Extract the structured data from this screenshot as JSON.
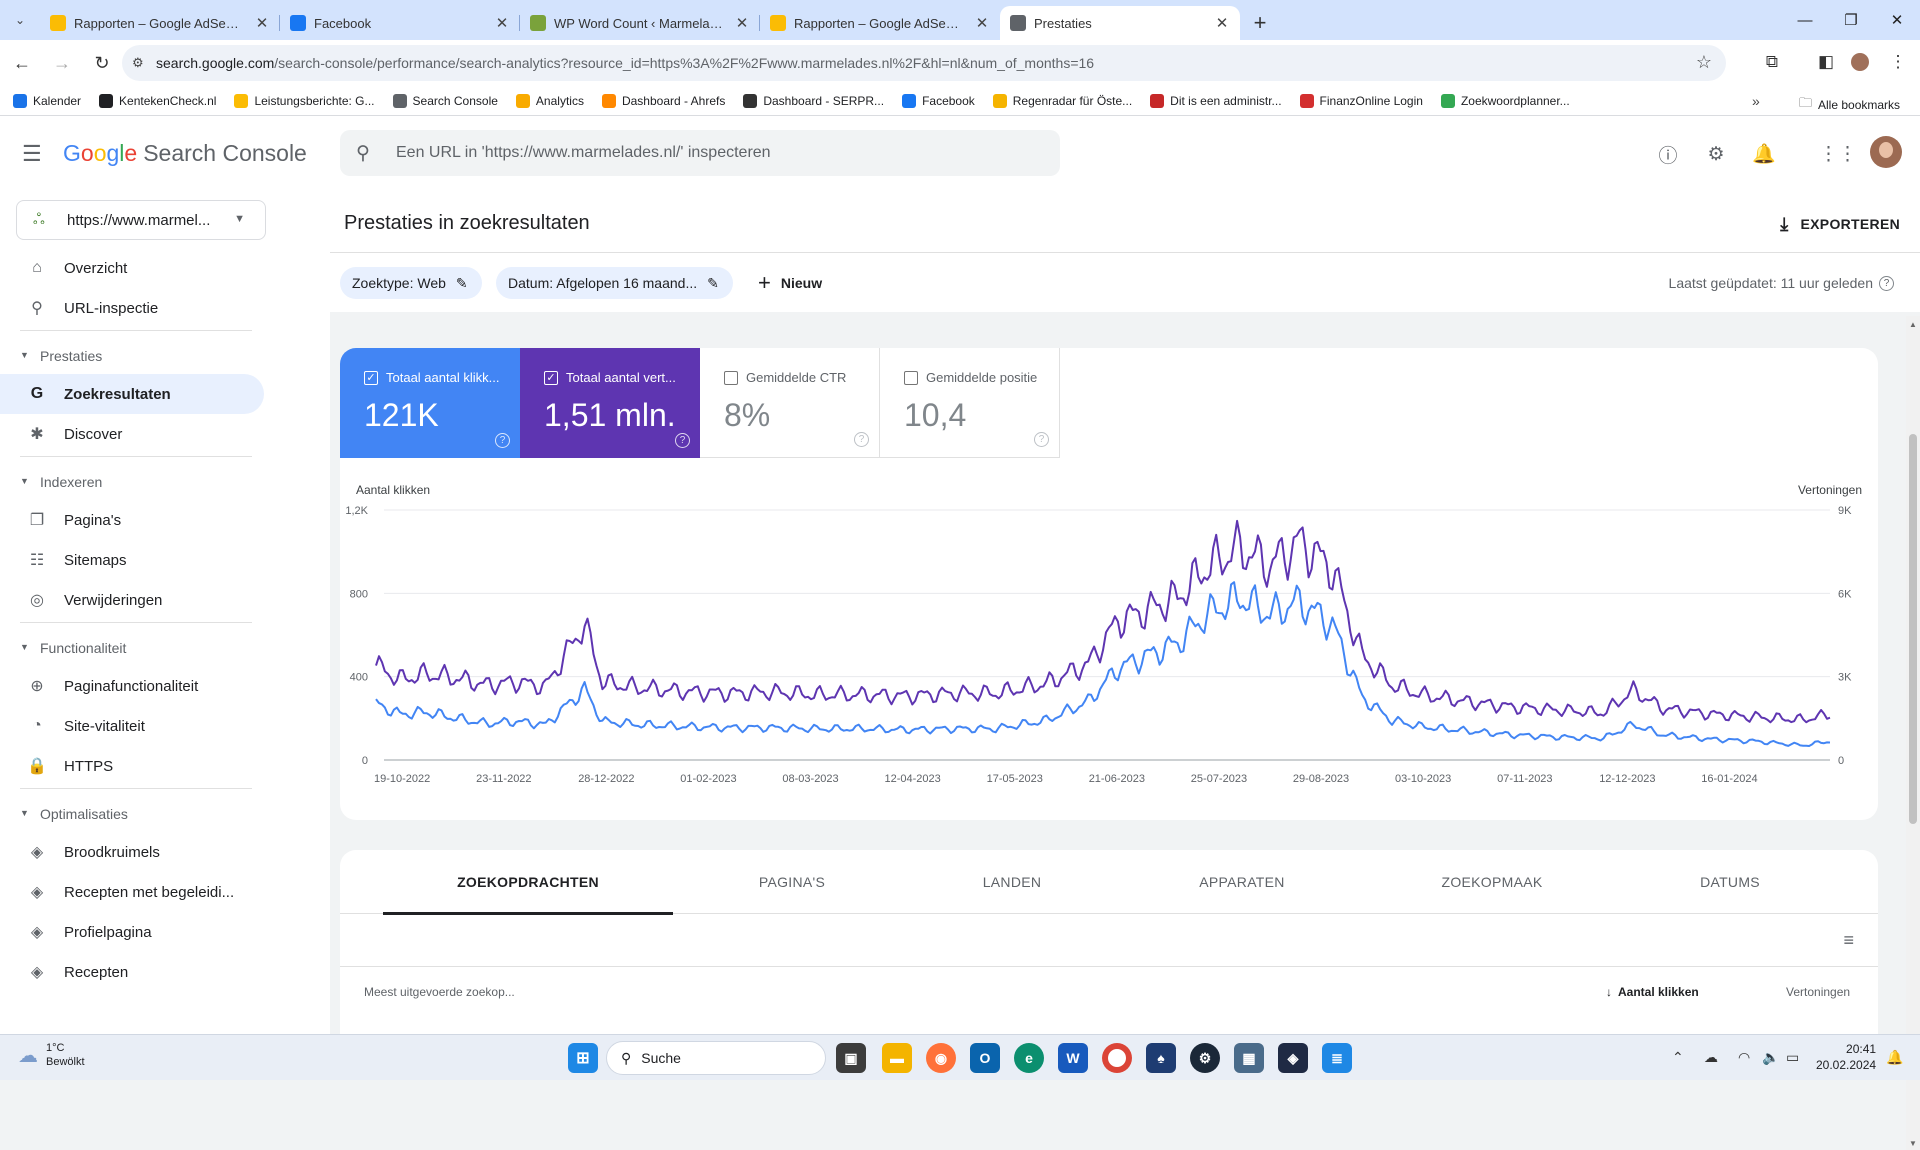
{
  "browser": {
    "tabs": [
      {
        "title": "Rapporten – Google AdSense",
        "icon": "adsense-icon",
        "color": "#fbbc04",
        "active": false
      },
      {
        "title": "Facebook",
        "icon": "facebook-icon",
        "color": "#1877f2",
        "active": false
      },
      {
        "title": "WP Word Count ‹ Marmelades",
        "icon": "wordpress-icon",
        "color": "#7aa23b",
        "active": false
      },
      {
        "title": "Rapporten – Google AdSense",
        "icon": "adsense-icon",
        "color": "#fbbc04",
        "active": false
      },
      {
        "title": "Prestaties",
        "icon": "search-console-icon",
        "color": "#5f6368",
        "active": true
      }
    ],
    "url_host": "search.google.com",
    "url_path": "/search-console/performance/search-analytics?resource_id=https%3A%2F%2Fwww.marmelades.nl%2F&hl=nl&num_of_months=16",
    "bookmarks": [
      {
        "label": "Kalender",
        "color": "#1a73e8"
      },
      {
        "label": "KentekenCheck.nl",
        "color": "#202124"
      },
      {
        "label": "Leistungsberichte: G...",
        "color": "#fbbc04"
      },
      {
        "label": "Search Console",
        "color": "#5f6368"
      },
      {
        "label": "Analytics",
        "color": "#f9ab00"
      },
      {
        "label": "Dashboard - Ahrefs",
        "color": "#ff8800"
      },
      {
        "label": "Dashboard - SERPR...",
        "color": "#333333"
      },
      {
        "label": "Facebook",
        "color": "#1877f2"
      },
      {
        "label": "Regenradar für Öste...",
        "color": "#f5b400"
      },
      {
        "label": "Dit is een administr...",
        "color": "#c62828"
      },
      {
        "label": "FinanzOnline Login",
        "color": "#d32f2f"
      },
      {
        "label": "Zoekwoordplanner...",
        "color": "#34a853"
      }
    ],
    "all_bookmarks": "Alle bookmarks"
  },
  "header": {
    "logo_google": "Google",
    "logo_product": "Search Console",
    "search_placeholder": "Een URL in 'https://www.marmelades.nl/' inspecteren"
  },
  "sidebar": {
    "property": "https://www.marmel...",
    "items": [
      {
        "type": "item",
        "label": "Overzicht",
        "icon": "home-icon"
      },
      {
        "type": "item",
        "label": "URL-inspectie",
        "icon": "search-icon"
      },
      {
        "type": "section",
        "label": "Prestaties"
      },
      {
        "type": "item",
        "label": "Zoekresultaten",
        "icon": "google-g-icon",
        "selected": true
      },
      {
        "type": "item",
        "label": "Discover",
        "icon": "asterisk-icon"
      },
      {
        "type": "section",
        "label": "Indexeren"
      },
      {
        "type": "item",
        "label": "Pagina's",
        "icon": "pages-icon"
      },
      {
        "type": "item",
        "label": "Sitemaps",
        "icon": "sitemap-icon"
      },
      {
        "type": "item",
        "label": "Verwijderingen",
        "icon": "eye-off-icon"
      },
      {
        "type": "section",
        "label": "Functionaliteit"
      },
      {
        "type": "item",
        "label": "Paginafunctionaliteit",
        "icon": "plus-circle-icon"
      },
      {
        "type": "item",
        "label": "Site-vitaliteit",
        "icon": "speed-icon"
      },
      {
        "type": "item",
        "label": "HTTPS",
        "icon": "lock-icon"
      },
      {
        "type": "section",
        "label": "Optimalisaties"
      },
      {
        "type": "item",
        "label": "Broodkruimels",
        "icon": "layers-icon"
      },
      {
        "type": "item",
        "label": "Recepten met begeleidi...",
        "icon": "layers-icon"
      },
      {
        "type": "item",
        "label": "Profielpagina",
        "icon": "layers-icon"
      },
      {
        "type": "item",
        "label": "Recepten",
        "icon": "layers-icon"
      }
    ]
  },
  "main": {
    "title": "Prestaties in zoekresultaten",
    "export_label": "EXPORTEREN",
    "filters": [
      "Zoektype: Web",
      "Datum: Afgelopen 16 maand..."
    ],
    "new_label": "Nieuw",
    "last_updated": "Laatst geüpdatet: 11 uur geleden",
    "metrics": [
      {
        "label": "Totaal aantal klikk...",
        "value": "121K",
        "checked": true,
        "color": "#4285f4"
      },
      {
        "label": "Totaal aantal vert...",
        "value": "1,51 mln.",
        "checked": true,
        "color": "#5e35b1"
      },
      {
        "label": "Gemiddelde CTR",
        "value": "8%",
        "checked": false,
        "color": ""
      },
      {
        "label": "Gemiddelde positie",
        "value": "10,4",
        "checked": false,
        "color": ""
      }
    ],
    "dim_tabs": [
      "ZOEKOPDRACHTEN",
      "PAGINA'S",
      "LANDEN",
      "APPARATEN",
      "ZOEKOPMAAK",
      "DATUMS"
    ],
    "table_headers": {
      "query": "Meest uitgevoerde zoekop...",
      "clicks": "Aantal klikken",
      "impressions": "Vertoningen"
    }
  },
  "chart_data": {
    "type": "line",
    "left_axis_label": "Aantal klikken",
    "right_axis_label": "Vertoningen",
    "left_ticks": [
      "0",
      "400",
      "800",
      "1,2K"
    ],
    "left_ylim": [
      0,
      1200
    ],
    "right_ticks": [
      "0",
      "3K",
      "6K",
      "9K"
    ],
    "right_ylim": [
      0,
      9000
    ],
    "x_ticks": [
      "19-10-2022",
      "23-11-2022",
      "28-12-2022",
      "01-02-2023",
      "08-03-2023",
      "12-04-2023",
      "17-05-2023",
      "21-06-2023",
      "25-07-2023",
      "29-08-2023",
      "03-10-2023",
      "07-11-2023",
      "12-12-2023",
      "16-01-2024"
    ],
    "x_start": "2022-10-19",
    "x_end": "2024-02-19",
    "series": [
      {
        "name": "Totaal aantal klikken",
        "axis": "left",
        "color": "#4285f4",
        "points": [
          [
            "2022-10-19",
            270
          ],
          [
            "2022-10-27",
            220
          ],
          [
            "2022-11-05",
            230
          ],
          [
            "2022-11-15",
            200
          ],
          [
            "2022-11-25",
            175
          ],
          [
            "2022-12-05",
            185
          ],
          [
            "2022-12-15",
            170
          ],
          [
            "2022-12-28",
            340
          ],
          [
            "2023-01-03",
            185
          ],
          [
            "2023-01-15",
            170
          ],
          [
            "2023-02-01",
            160
          ],
          [
            "2023-02-15",
            155
          ],
          [
            "2023-03-01",
            155
          ],
          [
            "2023-03-15",
            150
          ],
          [
            "2023-04-01",
            150
          ],
          [
            "2023-04-15",
            145
          ],
          [
            "2023-05-01",
            150
          ],
          [
            "2023-05-15",
            150
          ],
          [
            "2023-06-01",
            190
          ],
          [
            "2023-06-15",
            280
          ],
          [
            "2023-06-25",
            440
          ],
          [
            "2023-07-05",
            500
          ],
          [
            "2023-07-15",
            560
          ],
          [
            "2023-07-25",
            700
          ],
          [
            "2023-08-05",
            780
          ],
          [
            "2023-08-15",
            700
          ],
          [
            "2023-08-25",
            760
          ],
          [
            "2023-09-05",
            650
          ],
          [
            "2023-09-15",
            300
          ],
          [
            "2023-09-25",
            190
          ],
          [
            "2023-10-05",
            160
          ],
          [
            "2023-10-20",
            140
          ],
          [
            "2023-11-05",
            120
          ],
          [
            "2023-11-20",
            110
          ],
          [
            "2023-12-05",
            105
          ],
          [
            "2023-12-15",
            170
          ],
          [
            "2023-12-25",
            120
          ],
          [
            "2024-01-10",
            100
          ],
          [
            "2024-01-25",
            90
          ],
          [
            "2024-02-10",
            70
          ],
          [
            "2024-02-19",
            90
          ]
        ]
      },
      {
        "name": "Totaal aantal vertoningen",
        "axis": "right",
        "color": "#5e35b1",
        "points": [
          [
            "2022-10-19",
            3400
          ],
          [
            "2022-10-27",
            2900
          ],
          [
            "2022-11-05",
            3100
          ],
          [
            "2022-11-15",
            2950
          ],
          [
            "2022-11-25",
            2700
          ],
          [
            "2022-12-05",
            2800
          ],
          [
            "2022-12-15",
            2650
          ],
          [
            "2022-12-28",
            4900
          ],
          [
            "2023-01-03",
            2800
          ],
          [
            "2023-01-15",
            2600
          ],
          [
            "2023-02-01",
            2450
          ],
          [
            "2023-02-15",
            2400
          ],
          [
            "2023-03-01",
            2450
          ],
          [
            "2023-03-15",
            2350
          ],
          [
            "2023-04-01",
            2350
          ],
          [
            "2023-04-15",
            2300
          ],
          [
            "2023-05-01",
            2400
          ],
          [
            "2023-05-15",
            2400
          ],
          [
            "2023-06-01",
            2750
          ],
          [
            "2023-06-15",
            3450
          ],
          [
            "2023-06-25",
            5000
          ],
          [
            "2023-07-05",
            5400
          ],
          [
            "2023-07-15",
            5850
          ],
          [
            "2023-07-25",
            6950
          ],
          [
            "2023-08-05",
            7650
          ],
          [
            "2023-08-15",
            7000
          ],
          [
            "2023-08-25",
            7850
          ],
          [
            "2023-09-05",
            6900
          ],
          [
            "2023-09-15",
            3750
          ],
          [
            "2023-09-25",
            2700
          ],
          [
            "2023-10-05",
            2350
          ],
          [
            "2023-10-20",
            2100
          ],
          [
            "2023-11-05",
            1900
          ],
          [
            "2023-11-20",
            1800
          ],
          [
            "2023-12-05",
            1700
          ],
          [
            "2023-12-15",
            2500
          ],
          [
            "2023-12-25",
            1850
          ],
          [
            "2024-01-10",
            1650
          ],
          [
            "2024-01-25",
            1550
          ],
          [
            "2024-02-10",
            1450
          ],
          [
            "2024-02-19",
            1650
          ]
        ]
      }
    ]
  },
  "taskbar": {
    "temperature": "1°C",
    "weather": "Bewölkt",
    "search": "Suche",
    "time": "20:41",
    "date": "20.02.2024"
  }
}
